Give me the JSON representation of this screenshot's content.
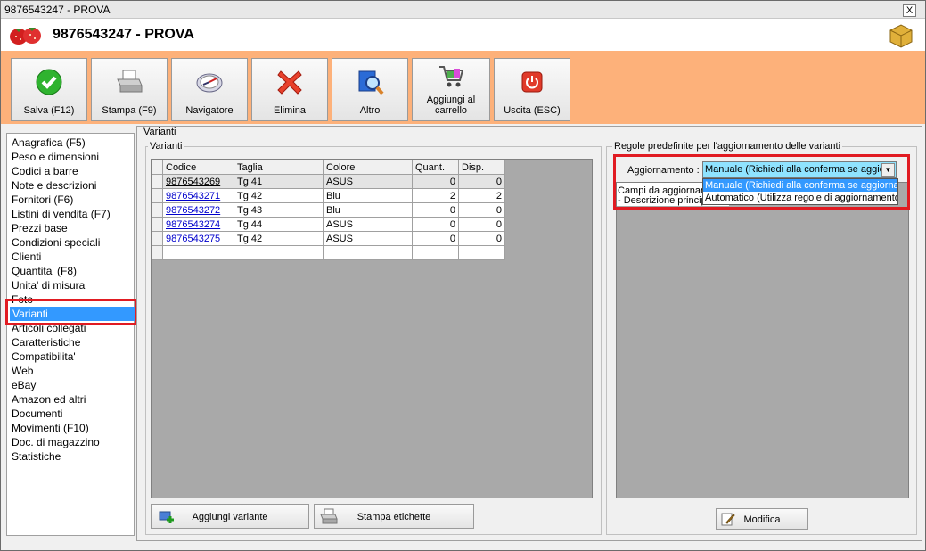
{
  "window": {
    "title": "9876543247 - PROVA",
    "close": "X"
  },
  "header": {
    "title": "9876543247 - PROVA"
  },
  "toolbar": {
    "buttons": [
      {
        "label": "Salva (F12)",
        "icon": "check-icon"
      },
      {
        "label": "Stampa (F9)",
        "icon": "printer-icon"
      },
      {
        "label": "Navigatore",
        "icon": "compass-icon"
      },
      {
        "label": "Elimina",
        "icon": "delete-x-icon"
      },
      {
        "label": "Altro",
        "icon": "magnifier-book-icon"
      },
      {
        "label": "Aggiungi al carrello",
        "icon": "cart-icon"
      },
      {
        "label": "Uscita (ESC)",
        "icon": "power-icon"
      }
    ]
  },
  "sidebar": {
    "items": [
      "Anagrafica (F5)",
      "Peso e dimensioni",
      "Codici a barre",
      "Note e descrizioni",
      "Fornitori (F6)",
      "Listini di vendita (F7)",
      "Prezzi base",
      "Condizioni speciali",
      "Clienti",
      "Quantita' (F8)",
      "Unita' di misura",
      "Foto",
      "Varianti",
      "Articoli collegati",
      "Caratteristiche",
      "Compatibilita'",
      "Web",
      "eBay",
      "Amazon ed altri",
      "Documenti",
      "Movimenti (F10)",
      "Doc. di magazzino",
      "Statistiche"
    ],
    "selected": "Varianti"
  },
  "main": {
    "frame_title": "Varianti",
    "variants_group": "Varianti",
    "columns": [
      "Codice",
      "Taglia",
      "Colore",
      "Quant.",
      "Disp."
    ],
    "rows": [
      [
        "9876543269",
        "Tg 41",
        "ASUS",
        "0",
        "0"
      ],
      [
        "9876543271",
        "Tg 42",
        "Blu",
        "2",
        "2"
      ],
      [
        "9876543272",
        "Tg 43",
        "Blu",
        "0",
        "0"
      ],
      [
        "9876543274",
        "Tg 44",
        "ASUS",
        "0",
        "0"
      ],
      [
        "9876543275",
        "Tg 42",
        "ASUS",
        "0",
        "0"
      ]
    ],
    "add_variant": "Aggiungi variante",
    "print_labels": "Stampa etichette"
  },
  "rules": {
    "group_title": "Regole predefinite per l'aggiornamento delle varianti",
    "update_label": "Aggiornamento :",
    "selected_value": "Manuale (Richiedi alla conferma se aggiorr",
    "options": [
      "Manuale (Richiedi alla conferma se aggiornare",
      "Automatico (Utilizza regole di aggiornamento s"
    ],
    "fields_label": "Campi da aggiornare",
    "fields_item": "- Descrizione principale",
    "edit_button": "Modifica"
  },
  "colors": {
    "toolbar": "#fdb17a",
    "selection": "#3399ff",
    "highlight_box": "#e11b22",
    "dropdown_selected": "#8fe3ff"
  }
}
